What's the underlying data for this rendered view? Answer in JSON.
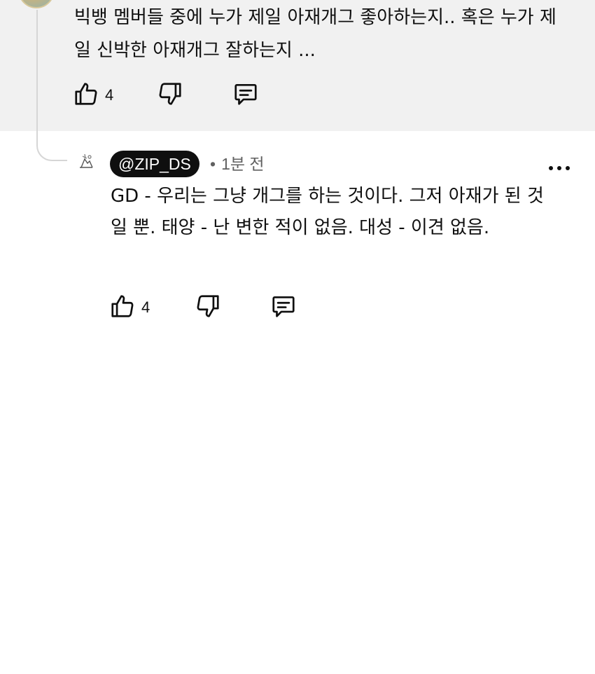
{
  "parent_comment": {
    "text": "빅뱅 멤버들 중에 누가 제일 아재개그 좋아하는지.. 혹은 누가 제일 신박한 아재개그 잘하는지 ...",
    "like_count": "4",
    "icons": {
      "like": "thumbs-up-icon",
      "dislike": "thumbs-down-icon",
      "reply": "reply-comment-icon"
    }
  },
  "reply": {
    "author_handle": "@ZIP_DS",
    "separator": "•",
    "time": "1분 전",
    "text": "GD - 우리는 그냥 개그를 하는 것이다. 그저 아재가 된 것일 뿐. 태양 - 난 변한 적이 없음. 대성 - 이견 없음.",
    "like_count": "4",
    "icons": {
      "like": "thumbs-up-icon",
      "dislike": "thumbs-down-icon",
      "reply": "reply-comment-icon",
      "more": "more-dots-icon"
    }
  },
  "colors": {
    "highlight_bg": "#f1f1f1",
    "text": "#0f0f0f",
    "muted": "#606060",
    "badge_bg": "#0f0f0f",
    "badge_text": "#ffffff"
  }
}
